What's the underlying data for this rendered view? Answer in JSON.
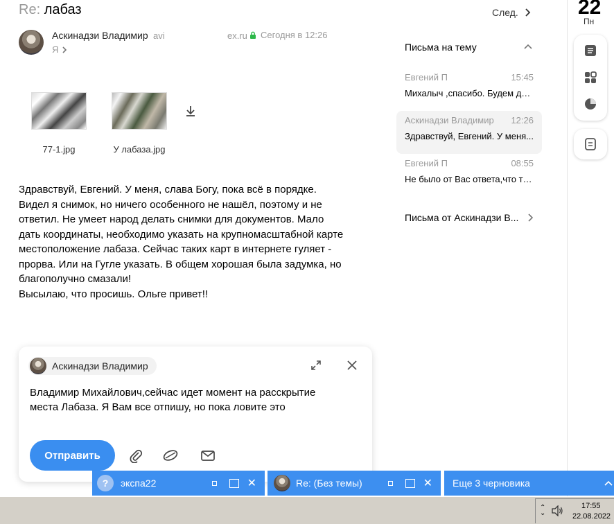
{
  "header": {
    "re": "Re:",
    "subject": "лабаз",
    "next_label": "След."
  },
  "message": {
    "sender_name": "Аскинадзи Владимир",
    "sender_email_start": "avi",
    "sender_email_end": "ex.ru",
    "date": "Сегодня в 12:26",
    "to": "Я",
    "attachments": [
      {
        "name": "77-1.jpg"
      },
      {
        "name": "У лабаза.jpg"
      }
    ],
    "body": "Здравствуй, Евгений. У меня, слава Богу, пока всё в порядке.\nВидел я снимок, но ничего особенного не нашёл, поэтому и не\nответил. Не умеет народ делать снимки для документов. Мало\nдать координаты, необходимо указать на крупномасштабной карте\nместоположение лабаза. Сейчас таких карт в интернете гуляет -\nпрорва. Или на Гугле указать. В общем хорошая была задумка, но\nблагополучно смазали!\nВысылаю, что просишь. Ольге привет!!"
  },
  "thread": {
    "title": "Письма на тему",
    "items": [
      {
        "from": "Евгений П",
        "time": "15:45",
        "snippet": "Михалыч ,спасибо. Будем де..."
      },
      {
        "from": "Аскинадзи Владимир",
        "time": "12:26",
        "snippet": "Здравствуй, Евгений. У меня..."
      },
      {
        "from": "Евгений П",
        "time": "08:55",
        "snippet": "Не было от Вас ответа,что то ..."
      }
    ],
    "from_link": "Письма от Аскинадзи В..."
  },
  "calendar": {
    "day": "22",
    "weekday": "Пн"
  },
  "compose": {
    "recipient": "Аскинадзи Владимир",
    "text": "Владимир Михайлович,сейчас идет момент на расскрытие\nместа Лабаза. Я  Вам все отпишу, но пока ловите это",
    "send_label": "Отправить"
  },
  "drafts": [
    {
      "title": "экспа22"
    },
    {
      "title": "Re: (Без темы)"
    }
  ],
  "more_drafts": "Еще 3 черновика",
  "taskbar": {
    "time": "17:55",
    "date": "22.08.2022"
  },
  "colors": {
    "accent": "#3a8ef0",
    "draft_bar": "#3d8ff0",
    "muted": "#999999"
  }
}
